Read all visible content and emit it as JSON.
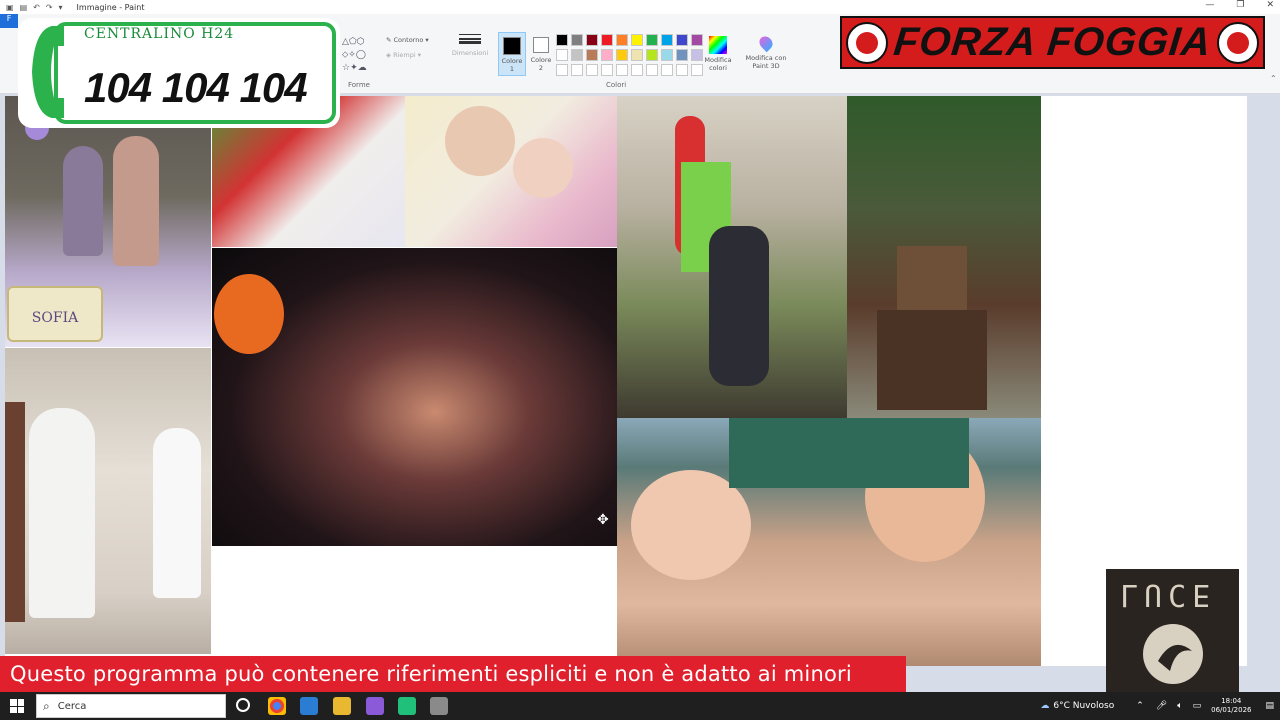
{
  "window": {
    "title": "Immagine - Paint",
    "menu_file": "F"
  },
  "ribbon": {
    "groups": {
      "shapes": "Forme",
      "colors": "Colori"
    },
    "tools": {
      "outline": "Contorno",
      "fill": "Riempi",
      "size": "Dimensioni",
      "color1": "Colore 1",
      "color2": "Colore 2",
      "edit_colors": "Modifica colori",
      "edit_paint3d": "Modifica con Paint 3D"
    },
    "palette": [
      "#000000",
      "#7f7f7f",
      "#880015",
      "#ed1c24",
      "#ff7f27",
      "#fff200",
      "#22b14c",
      "#00a2e8",
      "#3f48cc",
      "#a349a4",
      "#ffffff",
      "#c3c3c3",
      "#b97a57",
      "#ffaec9",
      "#ffc90e",
      "#efe4b0",
      "#b5e61d",
      "#99d9ea",
      "#7092be",
      "#c8bfe7"
    ]
  },
  "overlays": {
    "phone_caption": "CENTRALINO H24",
    "phone_number": "104 104 104",
    "banner": "FORZA FOGGIA",
    "warning": "Questo programma  può contenere riferimenti espliciti e non è adatto ai minori",
    "luce_logo": "LUCE"
  },
  "photos": {
    "cake_label": "SOFIA"
  },
  "taskbar": {
    "search_placeholder": "Cerca",
    "weather": "6°C  Nuvoloso",
    "time": "18:04",
    "date": "06/01/2026"
  },
  "colors": {
    "accent_green": "#2bb24c",
    "banner_red": "#d41c1c",
    "warning_red": "#e0202c"
  }
}
